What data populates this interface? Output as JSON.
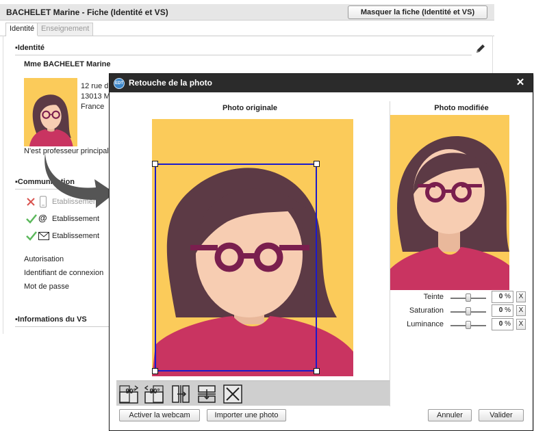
{
  "sheet": {
    "title": "BACHELET Marine - Fiche (Identité et VS)",
    "hide_button": "Masquer la fiche (Identité et VS)",
    "tabs": [
      "Identité",
      "Enseignement"
    ],
    "section_identity": "Identité",
    "person_name": "Mme BACHELET Marine",
    "address": [
      "12 rue d",
      "13013  M",
      "France"
    ],
    "not_principal": "N'est professeur principal",
    "section_communication": "Communication",
    "communication": [
      {
        "status": "no",
        "channel": "phone-icon",
        "label": "Etablissement"
      },
      {
        "status": "yes",
        "channel": "at-icon",
        "label": "Etablissement"
      },
      {
        "status": "yes",
        "channel": "envelope-icon",
        "label": "Etablissement"
      }
    ],
    "labels": [
      "Autorisation",
      "Identifiant de connexion",
      "Mot de passe"
    ],
    "section_vs": "Informations du VS"
  },
  "dialog": {
    "title": "Retouche de la photo",
    "original_title": "Photo originale",
    "modified_title": "Photo modifiée",
    "adjustments": [
      {
        "label": "Teinte",
        "value": "0",
        "unit": "%",
        "reset": "X",
        "level": 0.5
      },
      {
        "label": "Saturation",
        "value": "0",
        "unit": "%",
        "reset": "X",
        "level": 0.5
      },
      {
        "label": "Luminance",
        "value": "0",
        "unit": "%",
        "reset": "X",
        "level": 0.5
      }
    ],
    "rotate_cw_label": "90°",
    "rotate_ccw_label": "90°",
    "buttons": {
      "webcam": "Activer la webcam",
      "import": "Importer une photo",
      "cancel": "Annuler",
      "ok": "Valider"
    },
    "app_icon": "EDT"
  },
  "colors": {
    "photo_bg": "#fbcb5a",
    "hair": "#5c3a45",
    "skin": "#f7cdb2",
    "glasses": "#7a1f4e",
    "shirt": "#c93461",
    "crop": "#1a1acc"
  }
}
